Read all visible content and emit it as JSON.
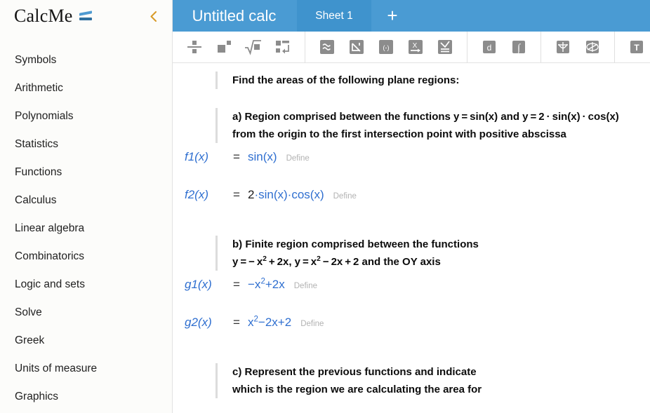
{
  "sidebar": {
    "brand": "CalcMe",
    "brand_mark_icon": "equals-slanted-icon",
    "collapse_icon": "chevron-left-icon",
    "collapse_color": "#d89b2a",
    "items": [
      {
        "label": "Symbols"
      },
      {
        "label": "Arithmetic"
      },
      {
        "label": "Polynomials"
      },
      {
        "label": "Statistics"
      },
      {
        "label": "Functions"
      },
      {
        "label": "Calculus"
      },
      {
        "label": "Linear algebra"
      },
      {
        "label": "Combinatorics"
      },
      {
        "label": "Logic and sets"
      },
      {
        "label": "Solve"
      },
      {
        "label": "Greek"
      },
      {
        "label": "Units of measure"
      },
      {
        "label": "Graphics"
      }
    ]
  },
  "header": {
    "accent_color": "#4a9bd3",
    "active_tab_color": "#3f93cd",
    "doc_title": "Untitled calc",
    "sheet_tab": "Sheet 1",
    "add_tab": "+"
  },
  "toolbar": {
    "groups": [
      {
        "buttons": [
          {
            "icon": "fraction-icon"
          },
          {
            "icon": "superscript-icon"
          },
          {
            "icon": "square-root-icon"
          },
          {
            "icon": "piecewise-icon"
          }
        ]
      },
      {
        "buttons": [
          {
            "icon": "approx-equal-icon"
          },
          {
            "icon": "not-symbol-icon"
          },
          {
            "icon": "interval-icon"
          },
          {
            "icon": "assign-variable-icon"
          },
          {
            "icon": "system-equations-icon"
          }
        ]
      },
      {
        "buttons": [
          {
            "icon": "derivative-icon"
          },
          {
            "icon": "integral-icon"
          }
        ]
      },
      {
        "buttons": [
          {
            "icon": "plot-2d-icon"
          },
          {
            "icon": "plot-3d-icon"
          }
        ]
      },
      {
        "buttons": [
          {
            "icon": "text-icon"
          }
        ]
      }
    ]
  },
  "content": {
    "intro": {
      "lines": [
        "Find the areas of the following plane regions:"
      ]
    },
    "part_a": {
      "line1_prefix": "a) Region comprised between the functions y = sin(x) and y = 2 · sin(x) · cos(x)",
      "line2": "from the origin to the first intersection point with positive abscissa"
    },
    "f1": {
      "name": "f1(x)",
      "equals": "=",
      "body": "sin(x)",
      "define": "Define"
    },
    "f2": {
      "name": "f2(x)",
      "equals": "=",
      "body_num": "2",
      "body_rest": "·sin(x)·cos(x)",
      "define": "Define"
    },
    "part_b": {
      "line1": "b) Finite region comprised between the functions",
      "line2_a": "y = − x",
      "line2_exp1": "2",
      "line2_b": " + 2x, y = x",
      "line2_exp2": "2",
      "line2_c": " − 2x + 2 and the OY axis"
    },
    "g1": {
      "name": "g1(x)",
      "equals": "=",
      "body_a": "−x",
      "body_exp": "2",
      "body_b": "+2x",
      "define": "Define"
    },
    "g2": {
      "name": "g2(x)",
      "equals": "=",
      "body_a": "x",
      "body_exp": "2",
      "body_b": "−2x+2",
      "define": "Define"
    },
    "part_c": {
      "line1": "c) Represent the previous functions and indicate",
      "line2": "which is the region we are calculating the area for"
    }
  }
}
